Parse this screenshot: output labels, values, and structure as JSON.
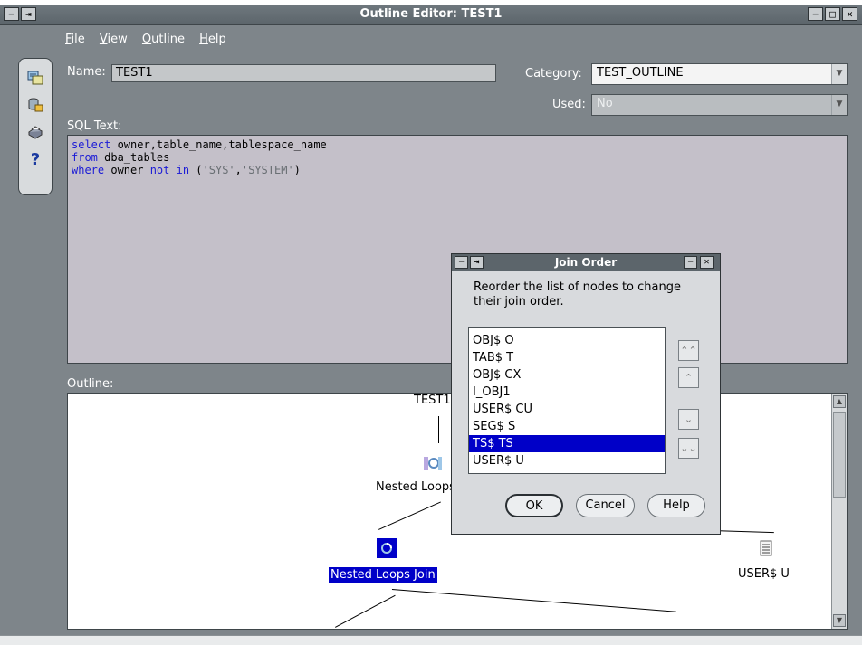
{
  "window": {
    "title": "Outline Editor: TEST1",
    "controls": {
      "menu": "−",
      "pin": "⇥",
      "minimize": "−",
      "maximize": "□",
      "close": "✕"
    }
  },
  "menu": [
    {
      "accel": "F",
      "rest": "ile"
    },
    {
      "accel": "V",
      "rest": "iew"
    },
    {
      "accel": "O",
      "rest": "utline"
    },
    {
      "accel": "H",
      "rest": "elp"
    }
  ],
  "toolbar": {
    "icons": [
      "sql-tuning-icon",
      "database-icon",
      "print-icon",
      "help-icon"
    ],
    "help_glyph": "?"
  },
  "form": {
    "name_label": "Name:",
    "name_value": "TEST1",
    "category_label": "Category:",
    "category_value": "TEST_OUTLINE",
    "used_label": "Used:",
    "used_value": "No",
    "sql_label": "SQL Text:",
    "outline_label": "Outline:"
  },
  "sql": {
    "line1": {
      "kw": "select",
      "rest": " owner,table_name,tablespace_name"
    },
    "line2": {
      "kw": "from",
      "rest": " dba_tables"
    },
    "line3": {
      "kw": "where",
      "mid": " owner ",
      "kw2": "not in",
      "open": " (",
      "s1": "'SYS'",
      "comma": ",",
      "s2": "'SYSTEM'",
      "close": ")"
    }
  },
  "outline_tree": {
    "root_label": "TEST1",
    "top_join_label": "Nested Loops Join",
    "selected_join_label": "Nested Loops Join",
    "right_node_label": "USER$ U"
  },
  "join_order_dialog": {
    "title": "Join Order",
    "message": "Reorder the list of nodes to change their join order.",
    "nodes": [
      "OBJ$ O",
      "TAB$ T",
      "OBJ$ CX",
      "I_OBJ1",
      "USER$ CU",
      "SEG$ S",
      "TS$ TS",
      "USER$ U"
    ],
    "selected_index": 6,
    "buttons": {
      "ok": "OK",
      "cancel": "Cancel",
      "help": "Help"
    }
  },
  "colors": {
    "window_bg": "#7e858a",
    "selection": "#0000c8",
    "sql_keyword": "#1a1ad6",
    "sql_string": "#6a6f74"
  }
}
